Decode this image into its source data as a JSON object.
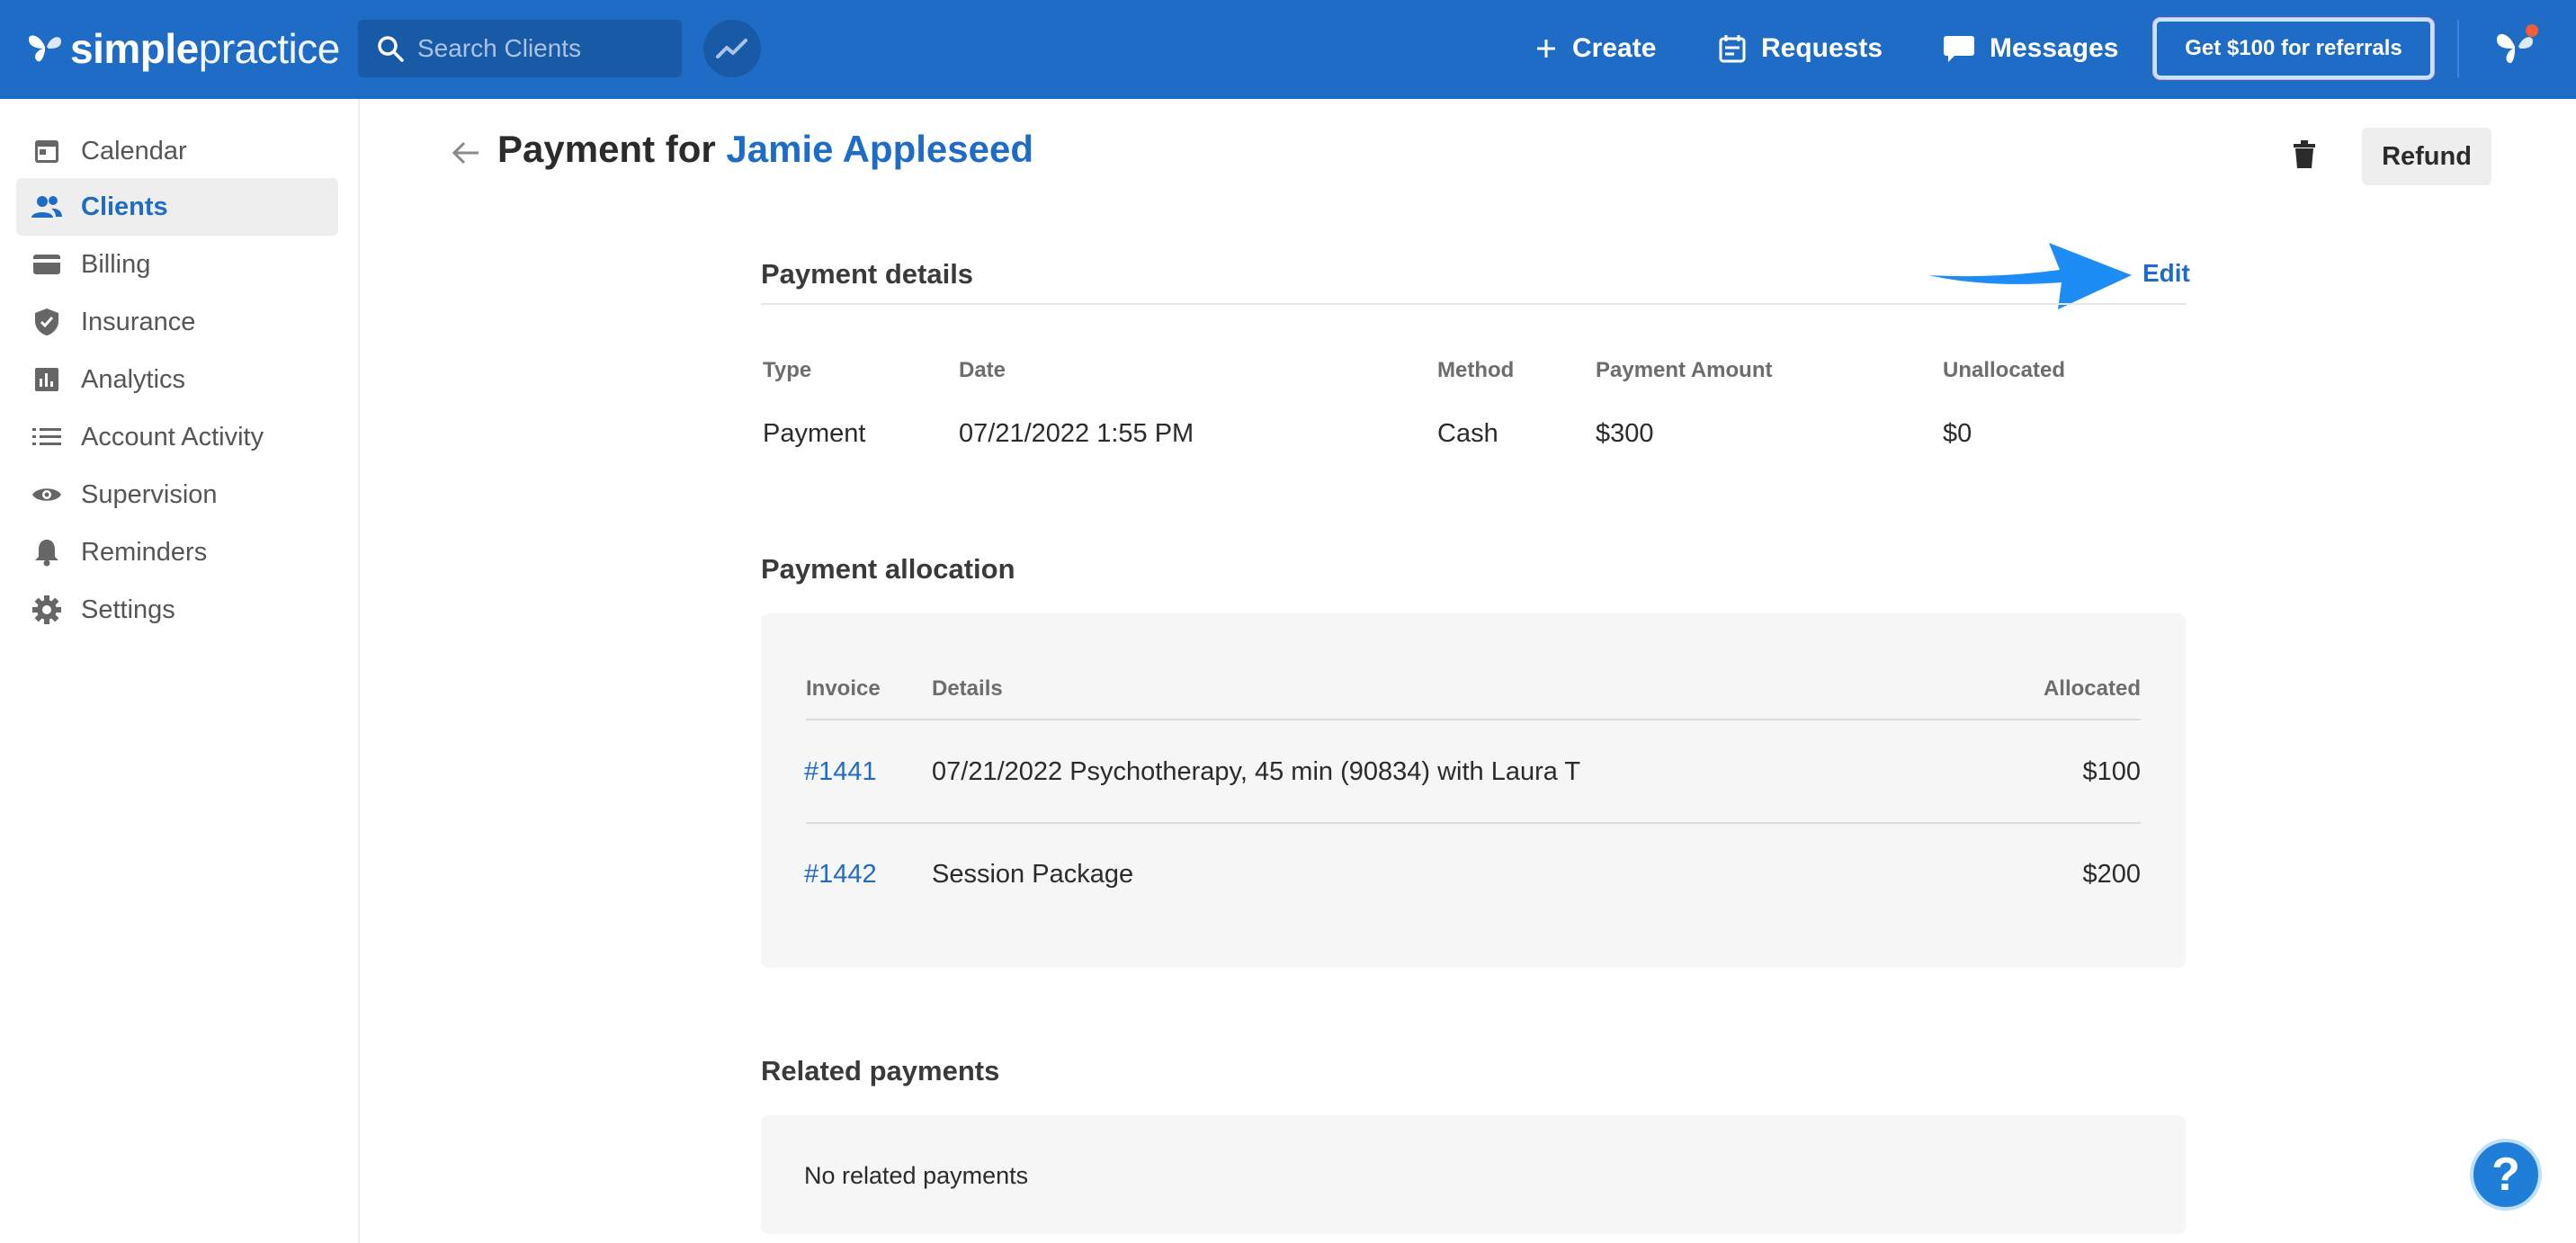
{
  "topbar": {
    "logo_bold": "simple",
    "logo_light": "practice",
    "search_placeholder": "Search Clients",
    "create_label": "Create",
    "requests_label": "Requests",
    "messages_label": "Messages",
    "referral_label": "Get $100 for referrals"
  },
  "sidebar": {
    "items": [
      {
        "label": "Calendar",
        "icon": "calendar-icon"
      },
      {
        "label": "Clients",
        "icon": "clients-icon",
        "active": true
      },
      {
        "label": "Billing",
        "icon": "billing-card-icon"
      },
      {
        "label": "Insurance",
        "icon": "shield-check-icon"
      },
      {
        "label": "Analytics",
        "icon": "bar-chart-icon"
      },
      {
        "label": "Account Activity",
        "icon": "list-icon"
      },
      {
        "label": "Supervision",
        "icon": "eye-icon"
      },
      {
        "label": "Reminders",
        "icon": "bell-icon"
      },
      {
        "label": "Settings",
        "icon": "gear-icon"
      }
    ]
  },
  "page": {
    "title_prefix": "Payment for",
    "client_name": "Jamie Appleseed",
    "refund_label": "Refund"
  },
  "payment_details": {
    "title": "Payment details",
    "edit_label": "Edit",
    "columns": [
      "Type",
      "Date",
      "Method",
      "Payment Amount",
      "Unallocated"
    ],
    "values": [
      "Payment",
      "07/21/2022 1:55 PM",
      "Cash",
      "$300",
      "$0"
    ]
  },
  "payment_allocation": {
    "title": "Payment allocation",
    "columns": [
      "Invoice",
      "Details",
      "Allocated"
    ],
    "rows": [
      {
        "invoice": "#1441",
        "details": "07/21/2022 Psychotherapy, 45 min (90834) with Laura T",
        "allocated": "$100"
      },
      {
        "invoice": "#1442",
        "details": "Session Package",
        "allocated": "$200"
      }
    ]
  },
  "related_payments": {
    "title": "Related payments",
    "empty_text": "No related payments"
  },
  "help_label": "?",
  "colors": {
    "brand_blue": "#1f6cc7",
    "annotation_arrow": "#1e8cf5"
  }
}
